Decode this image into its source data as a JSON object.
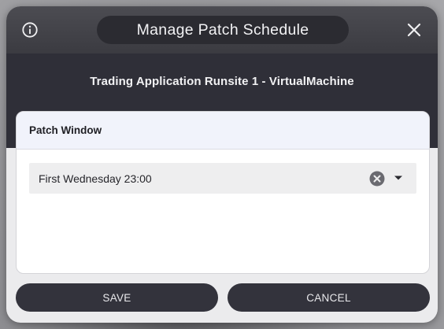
{
  "dialog": {
    "title": "Manage Patch Schedule",
    "subtitle": "Trading Application Runsite 1 - VirtualMachine",
    "info_icon": "info-circle-icon",
    "close_icon": "close-x-icon"
  },
  "patch_window": {
    "heading": "Patch Window",
    "selected_value": "First Wednesday 23:00",
    "clear_icon": "clear-circle-icon",
    "dropdown_icon": "caret-down-icon"
  },
  "actions": {
    "save_label": "SAVE",
    "cancel_label": "CANCEL"
  },
  "colors": {
    "header_bg": "#2f2f38",
    "button_bg": "#33333c",
    "card_header_bg": "#f1f3fb",
    "select_bg": "#eeeeef"
  }
}
